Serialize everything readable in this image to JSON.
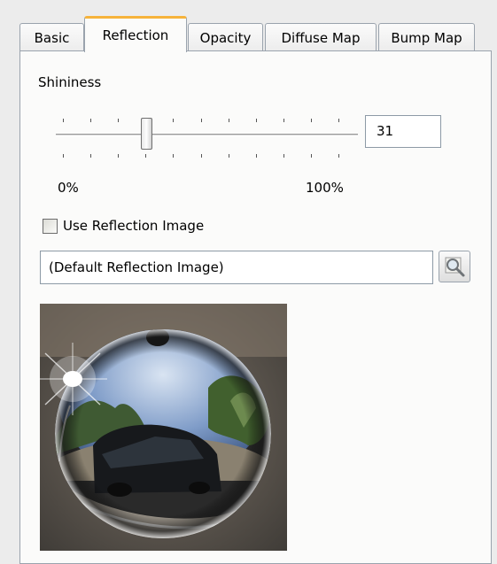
{
  "tabs": [
    {
      "label": "Basic",
      "active": false
    },
    {
      "label": "Reflection",
      "active": true
    },
    {
      "label": "Opacity",
      "active": false
    },
    {
      "label": "Diffuse Map",
      "active": false
    },
    {
      "label": "Bump Map",
      "active": false
    }
  ],
  "shininess": {
    "label": "Shininess",
    "value": "31",
    "min_label": "0%",
    "max_label": "100%"
  },
  "reflection_image": {
    "checkbox_label": "Use Reflection Image",
    "checked": false,
    "path_value": "(Default Reflection Image)",
    "browse_icon": "magnifier-icon",
    "preview_description": "chrome-sphere-environment-map"
  },
  "colors": {
    "active_tab_accent": "#f6b33b",
    "panel_background": "#fbfbfa",
    "border": "#9aa3ad"
  }
}
